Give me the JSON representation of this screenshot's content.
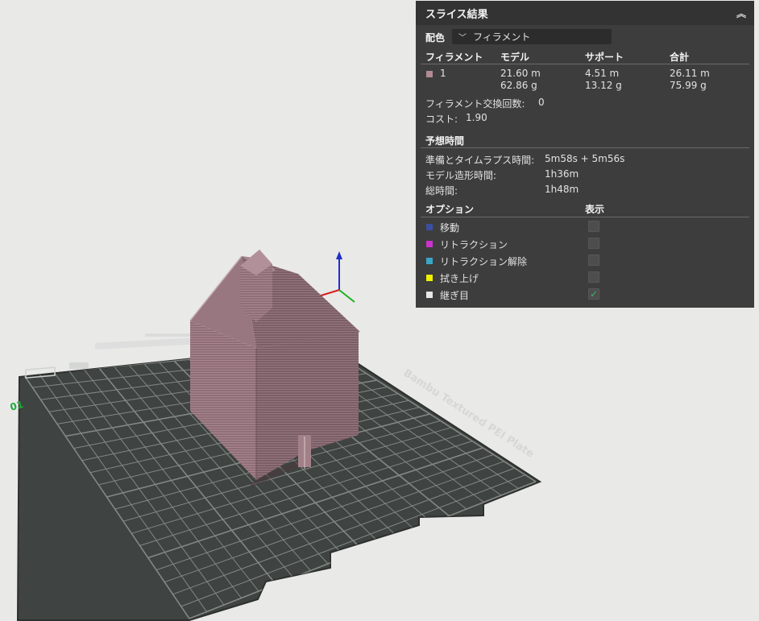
{
  "panel": {
    "title": "スライス結果",
    "collapse_icon": "double-chevron-up-icon",
    "color_scheme_label": "配色",
    "color_scheme_value": "フィラメント",
    "table_headers": [
      "フィラメント",
      "モデル",
      "サポート",
      "合計"
    ],
    "filament_rows": [
      {
        "id": "1",
        "color": "#b28b93",
        "model_length": "21.60 m",
        "model_weight": "62.86 g",
        "support_length": "4.51 m",
        "support_weight": "13.12 g",
        "total_length": "26.11 m",
        "total_weight": "75.99 g"
      }
    ],
    "filament_changes_label": "フィラメント交換回数:",
    "filament_changes_value": "0",
    "cost_label": "コスト:",
    "cost_value": "1.90",
    "time_section_title": "予想時間",
    "prep_time_label": "準備とタイムラプス時間:",
    "prep_time_value": "5m58s + 5m56s",
    "model_time_label": "モデル造形時間:",
    "model_time_value": "1h36m",
    "total_time_label": "総時間:",
    "total_time_value": "1h48m",
    "options_header": "オプション",
    "display_header": "表示",
    "options": [
      {
        "label": "移動",
        "color": "#3a4fa0",
        "checked": false
      },
      {
        "label": "リトラクション",
        "color": "#cc33cc",
        "checked": false
      },
      {
        "label": "リトラクション解除",
        "color": "#3aa6c8",
        "checked": false
      },
      {
        "label": "拭き上げ",
        "color": "#f0f000",
        "checked": false
      },
      {
        "label": "継ぎ目",
        "color": "#e8e8e8",
        "checked": true
      }
    ]
  },
  "scene": {
    "plate_label": "Bambu Textured PEI Plate",
    "plate_number": "01",
    "model_color": "#8a6a72",
    "plate_color": "#3f4341",
    "axis_colors": {
      "x": "#d42020",
      "y": "#20b020",
      "z": "#2030c8"
    }
  }
}
